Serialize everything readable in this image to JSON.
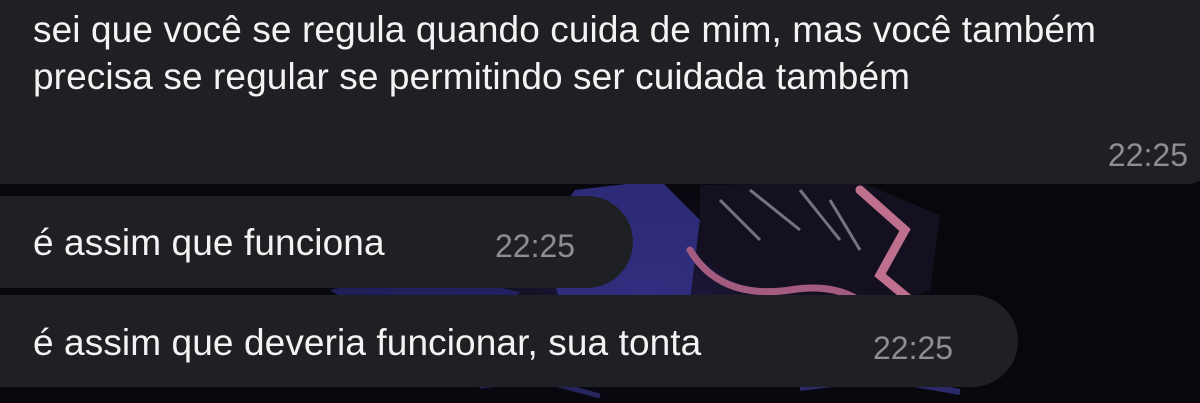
{
  "chat": {
    "messages": [
      {
        "text": "sei que você se regula quando cuida de mim, mas você também precisa se regular se permitindo ser cuidada também",
        "time": "22:25"
      },
      {
        "text": "é assim que funciona",
        "time": "22:25"
      },
      {
        "text": "é assim que deveria funcionar, sua tonta",
        "time": "22:25"
      }
    ]
  },
  "colors": {
    "background": "#07070c",
    "bubble": "#1f2023",
    "text": "#f3f3f3",
    "time": "#8d8e92",
    "wallpaper_blue": "#3c3a9c",
    "wallpaper_pink": "#b86a8e"
  }
}
